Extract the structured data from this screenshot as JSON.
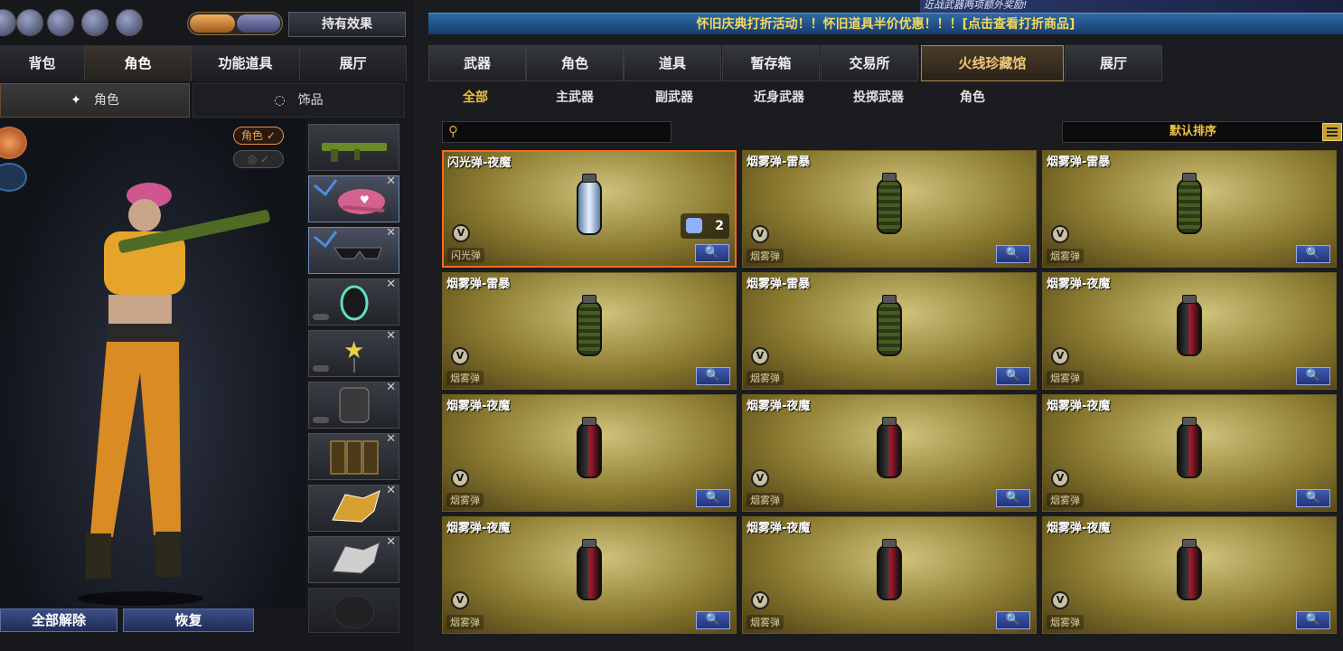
{
  "left": {
    "top_icons": [
      "avatar-icon",
      "stats-icon",
      "refresh-icon",
      "badge-icon",
      "bag-icon"
    ],
    "effects_button": "持有效果",
    "tabs": [
      {
        "label": "背包",
        "active": false
      },
      {
        "label": "角色",
        "active": true
      },
      {
        "label": "功能道具",
        "active": false
      },
      {
        "label": "展厅",
        "active": false
      }
    ],
    "subtabs": [
      {
        "label": "角色",
        "active": true
      },
      {
        "label": "饰品",
        "active": false
      }
    ],
    "character_tag": "角色",
    "slots": [
      "rifle",
      "cap",
      "sunglasses",
      "headset",
      "star-pendant",
      "backpack",
      "ammo-pouch",
      "golden-wolf",
      "silver-wolf",
      "empty"
    ],
    "unequip_all": "全部解除",
    "restore": "恢复"
  },
  "right": {
    "banner_top": "近战武器两项额外奖励!",
    "banner": "怀旧庆典打折活动！！怀旧道具半价优惠！！！[点击查看打折商品]",
    "tabs": [
      {
        "label": "武器",
        "active": false
      },
      {
        "label": "角色",
        "active": false
      },
      {
        "label": "道具",
        "active": false
      },
      {
        "label": "暂存箱",
        "active": false
      },
      {
        "label": "交易所",
        "active": false
      },
      {
        "label": "火线珍藏馆",
        "active": true
      },
      {
        "label": "展厅",
        "active": false
      }
    ],
    "categories": [
      {
        "label": "全部",
        "active": true
      },
      {
        "label": "主武器",
        "active": false
      },
      {
        "label": "副武器",
        "active": false
      },
      {
        "label": "近身武器",
        "active": false
      },
      {
        "label": "投掷武器",
        "active": false
      },
      {
        "label": "角色",
        "active": false
      }
    ],
    "search_placeholder": "",
    "sort_label": "默认排序",
    "zoom_icon": "🔍",
    "v_badge": "V",
    "items": [
      {
        "name": "闪光弹-夜魔",
        "type": "闪光弹",
        "style": "flash",
        "count": "2",
        "selected": true
      },
      {
        "name": "烟雾弹-雷暴",
        "type": "烟雾弹",
        "style": "smoke"
      },
      {
        "name": "烟雾弹-雷暴",
        "type": "烟雾弹",
        "style": "smoke"
      },
      {
        "name": "烟雾弹-雷暴",
        "type": "烟雾弹",
        "style": "smoke"
      },
      {
        "name": "烟雾弹-雷暴",
        "type": "烟雾弹",
        "style": "smoke"
      },
      {
        "name": "烟雾弹-夜魔",
        "type": "烟雾弹",
        "style": "night"
      },
      {
        "name": "烟雾弹-夜魔",
        "type": "烟雾弹",
        "style": "night"
      },
      {
        "name": "烟雾弹-夜魔",
        "type": "烟雾弹",
        "style": "night"
      },
      {
        "name": "烟雾弹-夜魔",
        "type": "烟雾弹",
        "style": "night"
      },
      {
        "name": "烟雾弹-夜魔",
        "type": "烟雾弹",
        "style": "night"
      },
      {
        "name": "烟雾弹-夜魔",
        "type": "烟雾弹",
        "style": "night"
      },
      {
        "name": "烟雾弹-夜魔",
        "type": "烟雾弹",
        "style": "night"
      }
    ]
  }
}
